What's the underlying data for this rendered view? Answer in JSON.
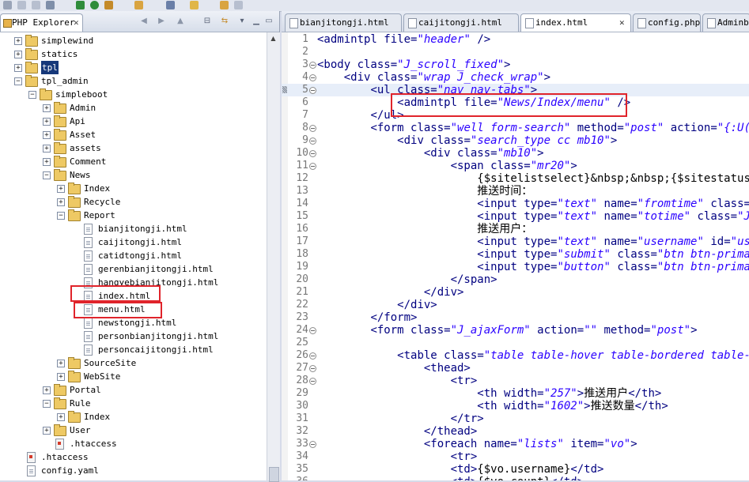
{
  "left_view": {
    "tab_label": "PHP Explorer",
    "close_glyph": "✕",
    "tree": [
      {
        "label": "simplewind",
        "indent": 1,
        "type": "folder",
        "expander": "+",
        "selected": false
      },
      {
        "label": "statics",
        "indent": 1,
        "type": "folder",
        "expander": "+",
        "selected": false
      },
      {
        "label": "tpl",
        "indent": 1,
        "type": "folder",
        "expander": "+",
        "selected": true
      },
      {
        "label": "tpl_admin",
        "indent": 1,
        "type": "folder",
        "expander": "-",
        "selected": false
      },
      {
        "label": "simpleboot",
        "indent": 2,
        "type": "folder",
        "expander": "-",
        "selected": false
      },
      {
        "label": "Admin",
        "indent": 3,
        "type": "folder",
        "expander": "+",
        "selected": false
      },
      {
        "label": "Api",
        "indent": 3,
        "type": "folder",
        "expander": "+",
        "selected": false
      },
      {
        "label": "Asset",
        "indent": 3,
        "type": "folder",
        "expander": "+",
        "selected": false
      },
      {
        "label": "assets",
        "indent": 3,
        "type": "folder",
        "expander": "+",
        "selected": false
      },
      {
        "label": "Comment",
        "indent": 3,
        "type": "folder",
        "expander": "+",
        "selected": false
      },
      {
        "label": "News",
        "indent": 3,
        "type": "folder",
        "expander": "-",
        "selected": false
      },
      {
        "label": "Index",
        "indent": 4,
        "type": "folder",
        "expander": "+",
        "selected": false
      },
      {
        "label": "Recycle",
        "indent": 4,
        "type": "folder",
        "expander": "+",
        "selected": false
      },
      {
        "label": "Report",
        "indent": 4,
        "type": "folder",
        "expander": "-",
        "selected": false
      },
      {
        "label": "bianjitongji.html",
        "indent": 5,
        "type": "file",
        "expander": "",
        "selected": false
      },
      {
        "label": "caijitongji.html",
        "indent": 5,
        "type": "file",
        "expander": "",
        "selected": false
      },
      {
        "label": "catidtongji.html",
        "indent": 5,
        "type": "file",
        "expander": "",
        "selected": false
      },
      {
        "label": "gerenbianjitongji.html",
        "indent": 5,
        "type": "file",
        "expander": "",
        "selected": false
      },
      {
        "label": "hangyebianjitongji.html",
        "indent": 5,
        "type": "file",
        "expander": "",
        "selected": false
      },
      {
        "label": "index.html",
        "indent": 5,
        "type": "file",
        "expander": "",
        "selected": false
      },
      {
        "label": "menu.html",
        "indent": 5,
        "type": "file",
        "expander": "",
        "selected": false
      },
      {
        "label": "newstongji.html",
        "indent": 5,
        "type": "file",
        "expander": "",
        "selected": false
      },
      {
        "label": "personbianjitongji.html",
        "indent": 5,
        "type": "file",
        "expander": "",
        "selected": false
      },
      {
        "label": "personcaijitongji.html",
        "indent": 5,
        "type": "file",
        "expander": "",
        "selected": false
      },
      {
        "label": "SourceSite",
        "indent": 4,
        "type": "folder",
        "expander": "+",
        "selected": false
      },
      {
        "label": "WebSite",
        "indent": 4,
        "type": "folder",
        "expander": "+",
        "selected": false
      },
      {
        "label": "Portal",
        "indent": 3,
        "type": "folder",
        "expander": "+",
        "selected": false
      },
      {
        "label": "Rule",
        "indent": 3,
        "type": "folder",
        "expander": "-",
        "selected": false
      },
      {
        "label": "Index",
        "indent": 4,
        "type": "folder",
        "expander": "+",
        "selected": false
      },
      {
        "label": "User",
        "indent": 3,
        "type": "folder",
        "expander": "+",
        "selected": false
      },
      {
        "label": ".htaccess",
        "indent": 3,
        "type": "redfile",
        "expander": "",
        "selected": false
      },
      {
        "label": ".htaccess",
        "indent": 1,
        "type": "redfile",
        "expander": "",
        "selected": false
      },
      {
        "label": "config.yaml",
        "indent": 1,
        "type": "file",
        "expander": "",
        "selected": false
      }
    ]
  },
  "editor": {
    "tabs": [
      {
        "label": "bianjitongji.html",
        "active": false,
        "close": ""
      },
      {
        "label": "caijitongji.html",
        "active": false,
        "close": ""
      },
      {
        "label": "index.html",
        "active": true,
        "close": "✕"
      },
      {
        "label": "config.php",
        "active": false,
        "close": ""
      },
      {
        "label": "Adminb",
        "active": false,
        "close": ""
      }
    ],
    "lines": [
      {
        "n": "1",
        "fold": false,
        "tokens": [
          [
            "tg",
            "<admintpl "
          ],
          [
            "at",
            "file="
          ],
          [
            "av",
            "\"header\""
          ],
          [
            "tg",
            " />"
          ]
        ]
      },
      {
        "n": "2",
        "fold": false,
        "tokens": []
      },
      {
        "n": "3",
        "fold": true,
        "tokens": [
          [
            "tg",
            "<body "
          ],
          [
            "at",
            "class="
          ],
          [
            "av",
            "\"J_scroll_fixed\""
          ],
          [
            "tg",
            ">"
          ]
        ]
      },
      {
        "n": "4",
        "fold": true,
        "tokens": [
          [
            "tx",
            "    "
          ],
          [
            "tg",
            "<div "
          ],
          [
            "at",
            "class="
          ],
          [
            "av",
            "\"wrap J_check_wrap\""
          ],
          [
            "tg",
            ">"
          ]
        ]
      },
      {
        "n": "5",
        "fold": true,
        "tokens": [
          [
            "tx",
            "        "
          ],
          [
            "tg",
            "<ul "
          ],
          [
            "at",
            "class="
          ],
          [
            "av",
            "\"nav nav-tabs\""
          ],
          [
            "tg",
            ">"
          ]
        ]
      },
      {
        "n": "6",
        "fold": false,
        "tokens": [
          [
            "tx",
            "            "
          ],
          [
            "tg",
            "<admintpl "
          ],
          [
            "at",
            "file="
          ],
          [
            "av",
            "\"News/Index/menu\""
          ],
          [
            "tg",
            " />"
          ]
        ]
      },
      {
        "n": "7",
        "fold": false,
        "tokens": [
          [
            "tx",
            "        "
          ],
          [
            "tg",
            "</ul>"
          ]
        ]
      },
      {
        "n": "8",
        "fold": true,
        "tokens": [
          [
            "tx",
            "        "
          ],
          [
            "tg",
            "<form "
          ],
          [
            "at",
            "class="
          ],
          [
            "av",
            "\"well form-search\""
          ],
          [
            "at",
            " method="
          ],
          [
            "av",
            "\"post\""
          ],
          [
            "at",
            " action="
          ],
          [
            "av",
            "\"{:U('Rep"
          ]
        ]
      },
      {
        "n": "9",
        "fold": true,
        "tokens": [
          [
            "tx",
            "            "
          ],
          [
            "tg",
            "<div "
          ],
          [
            "at",
            "class="
          ],
          [
            "av",
            "\"search_type cc mb10\""
          ],
          [
            "tg",
            ">"
          ]
        ]
      },
      {
        "n": "10",
        "fold": true,
        "tokens": [
          [
            "tx",
            "                "
          ],
          [
            "tg",
            "<div "
          ],
          [
            "at",
            "class="
          ],
          [
            "av",
            "\"mb10\""
          ],
          [
            "tg",
            ">"
          ]
        ]
      },
      {
        "n": "11",
        "fold": true,
        "tokens": [
          [
            "tx",
            "                    "
          ],
          [
            "tg",
            "<span "
          ],
          [
            "at",
            "class="
          ],
          [
            "av",
            "\"mr20\""
          ],
          [
            "tg",
            ">"
          ]
        ]
      },
      {
        "n": "12",
        "fold": false,
        "tokens": [
          [
            "tx",
            "                        {$sitelistselect}&nbsp;&nbsp;{$sitestatussele"
          ]
        ]
      },
      {
        "n": "13",
        "fold": false,
        "tokens": [
          [
            "tx",
            "                        推送时间："
          ]
        ]
      },
      {
        "n": "14",
        "fold": false,
        "tokens": [
          [
            "tx",
            "                        "
          ],
          [
            "tg",
            "<input "
          ],
          [
            "at",
            "type="
          ],
          [
            "av",
            "\"text\""
          ],
          [
            "at",
            " name="
          ],
          [
            "av",
            "\"fromtime\""
          ],
          [
            "at",
            " class="
          ],
          [
            "av",
            "\"J_"
          ]
        ]
      },
      {
        "n": "15",
        "fold": false,
        "tokens": [
          [
            "tx",
            "                        "
          ],
          [
            "tg",
            "<input "
          ],
          [
            "at",
            "type="
          ],
          [
            "av",
            "\"text\""
          ],
          [
            "at",
            " name="
          ],
          [
            "av",
            "\"totime\""
          ],
          [
            "at",
            " class="
          ],
          [
            "av",
            "\"J_da"
          ]
        ]
      },
      {
        "n": "16",
        "fold": false,
        "tokens": [
          [
            "tx",
            "                        推送用户："
          ]
        ]
      },
      {
        "n": "17",
        "fold": false,
        "tokens": [
          [
            "tx",
            "                        "
          ],
          [
            "tg",
            "<input "
          ],
          [
            "at",
            "type="
          ],
          [
            "av",
            "\"text\""
          ],
          [
            "at",
            " name="
          ],
          [
            "av",
            "\"username\""
          ],
          [
            "at",
            " id="
          ],
          [
            "av",
            "\"usern"
          ]
        ]
      },
      {
        "n": "18",
        "fold": false,
        "tokens": [
          [
            "tx",
            "                        "
          ],
          [
            "tg",
            "<input "
          ],
          [
            "at",
            "type="
          ],
          [
            "av",
            "\"submit\""
          ],
          [
            "at",
            " class="
          ],
          [
            "av",
            "\"btn btn-primary\""
          ]
        ]
      },
      {
        "n": "19",
        "fold": false,
        "tokens": [
          [
            "tx",
            "                        "
          ],
          [
            "tg",
            "<input "
          ],
          [
            "at",
            "type="
          ],
          [
            "av",
            "\"button\""
          ],
          [
            "at",
            " class="
          ],
          [
            "av",
            "\"btn btn-primary f"
          ]
        ]
      },
      {
        "n": "20",
        "fold": false,
        "tokens": [
          [
            "tx",
            "                    "
          ],
          [
            "tg",
            "</span>"
          ]
        ]
      },
      {
        "n": "21",
        "fold": false,
        "tokens": [
          [
            "tx",
            "                "
          ],
          [
            "tg",
            "</div>"
          ]
        ]
      },
      {
        "n": "22",
        "fold": false,
        "tokens": [
          [
            "tx",
            "            "
          ],
          [
            "tg",
            "</div>"
          ]
        ]
      },
      {
        "n": "23",
        "fold": false,
        "tokens": [
          [
            "tx",
            "        "
          ],
          [
            "tg",
            "</form>"
          ]
        ]
      },
      {
        "n": "24",
        "fold": true,
        "tokens": [
          [
            "tx",
            "        "
          ],
          [
            "tg",
            "<form "
          ],
          [
            "at",
            "class="
          ],
          [
            "av",
            "\"J_ajaxForm\""
          ],
          [
            "at",
            " action="
          ],
          [
            "av",
            "\"\""
          ],
          [
            "at",
            " method="
          ],
          [
            "av",
            "\"post\""
          ],
          [
            "tg",
            ">"
          ]
        ]
      },
      {
        "n": "25",
        "fold": false,
        "tokens": []
      },
      {
        "n": "26",
        "fold": true,
        "tokens": [
          [
            "tx",
            "            "
          ],
          [
            "tg",
            "<table "
          ],
          [
            "at",
            "class="
          ],
          [
            "av",
            "\"table table-hover table-bordered table-lis"
          ]
        ]
      },
      {
        "n": "27",
        "fold": true,
        "tokens": [
          [
            "tx",
            "                "
          ],
          [
            "tg",
            "<thead>"
          ]
        ]
      },
      {
        "n": "28",
        "fold": true,
        "tokens": [
          [
            "tx",
            "                    "
          ],
          [
            "tg",
            "<tr>"
          ]
        ]
      },
      {
        "n": "29",
        "fold": false,
        "tokens": [
          [
            "tx",
            "                        "
          ],
          [
            "tg",
            "<th "
          ],
          [
            "at",
            "width="
          ],
          [
            "av",
            "\"257\""
          ],
          [
            "tg",
            ">"
          ],
          [
            "tx",
            "推送用户"
          ],
          [
            "tg",
            "</th>"
          ]
        ]
      },
      {
        "n": "30",
        "fold": false,
        "tokens": [
          [
            "tx",
            "                        "
          ],
          [
            "tg",
            "<th "
          ],
          [
            "at",
            "width="
          ],
          [
            "av",
            "\"1602\""
          ],
          [
            "tg",
            ">"
          ],
          [
            "tx",
            "推送数量"
          ],
          [
            "tg",
            "</th>"
          ]
        ]
      },
      {
        "n": "31",
        "fold": false,
        "tokens": [
          [
            "tx",
            "                    "
          ],
          [
            "tg",
            "</tr>"
          ]
        ]
      },
      {
        "n": "32",
        "fold": false,
        "tokens": [
          [
            "tx",
            "                "
          ],
          [
            "tg",
            "</thead>"
          ]
        ]
      },
      {
        "n": "33",
        "fold": true,
        "tokens": [
          [
            "tx",
            "                "
          ],
          [
            "tg",
            "<foreach "
          ],
          [
            "at",
            "name="
          ],
          [
            "av",
            "\"lists\""
          ],
          [
            "at",
            " item="
          ],
          [
            "av",
            "\"vo\""
          ],
          [
            "tg",
            ">"
          ]
        ]
      },
      {
        "n": "34",
        "fold": false,
        "tokens": [
          [
            "tx",
            "                    "
          ],
          [
            "tg",
            "<tr>"
          ]
        ]
      },
      {
        "n": "35",
        "fold": false,
        "tokens": [
          [
            "tx",
            "                    "
          ],
          [
            "tg",
            "<td>"
          ],
          [
            "tx",
            "{$vo.username}"
          ],
          [
            "tg",
            "</td>"
          ]
        ]
      },
      {
        "n": "36",
        "fold": false,
        "tokens": [
          [
            "tx",
            "                    "
          ],
          [
            "tg",
            "<td>"
          ],
          [
            "tx",
            "{$vo.count}"
          ],
          [
            "tg",
            "</td>"
          ]
        ]
      }
    ]
  },
  "colors": {
    "tag": "#000080",
    "attr_value": "#2a00ff",
    "highlight_box": "#e0242b",
    "selection": "#16387a"
  }
}
